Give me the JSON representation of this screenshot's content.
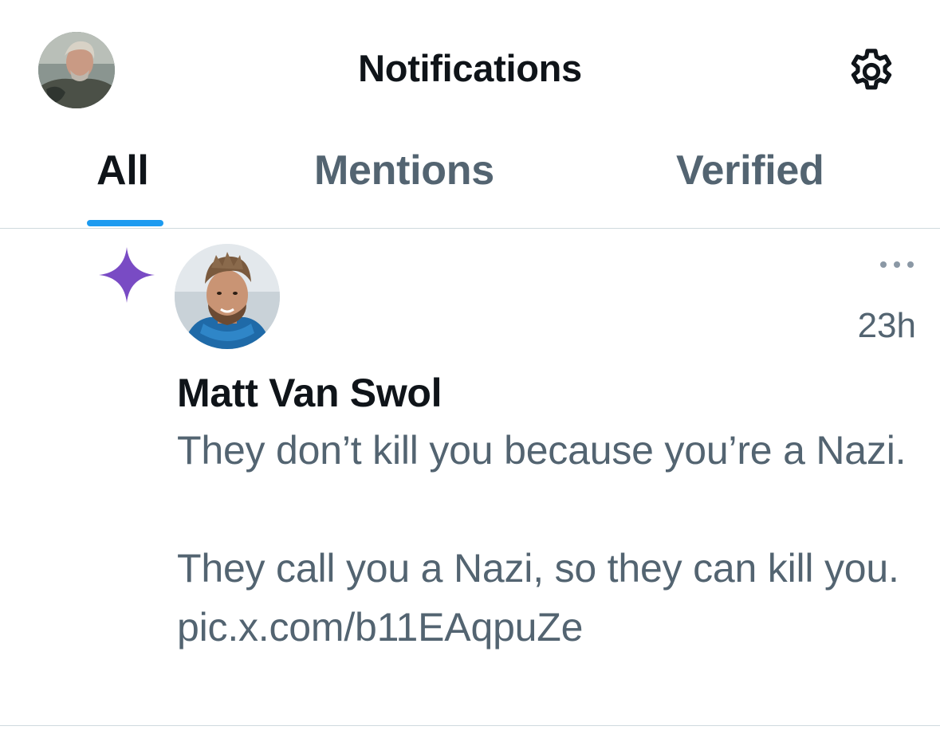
{
  "header": {
    "title": "Notifications",
    "avatar_icon": "user-avatar-icon",
    "settings_icon": "gear-icon"
  },
  "tabs": [
    {
      "label": "All",
      "active": true
    },
    {
      "label": "Mentions",
      "active": false
    },
    {
      "label": "Verified",
      "active": false
    }
  ],
  "notification": {
    "type_icon": "sparkle-icon",
    "author": "Matt Van Swol",
    "time": "23h",
    "more_icon": "more-dots-icon",
    "text": "They don’t kill you because you’re a Nazi.\n\nThey call you a Nazi, so they can kill you. ",
    "link": "pic.x.com/b11EAqpuZe"
  },
  "colors": {
    "accent": "#1d9bf0",
    "sparkle": "#794bc4",
    "primary_text": "#0f1419",
    "secondary_text": "#536471",
    "divider": "#cfd9de"
  }
}
